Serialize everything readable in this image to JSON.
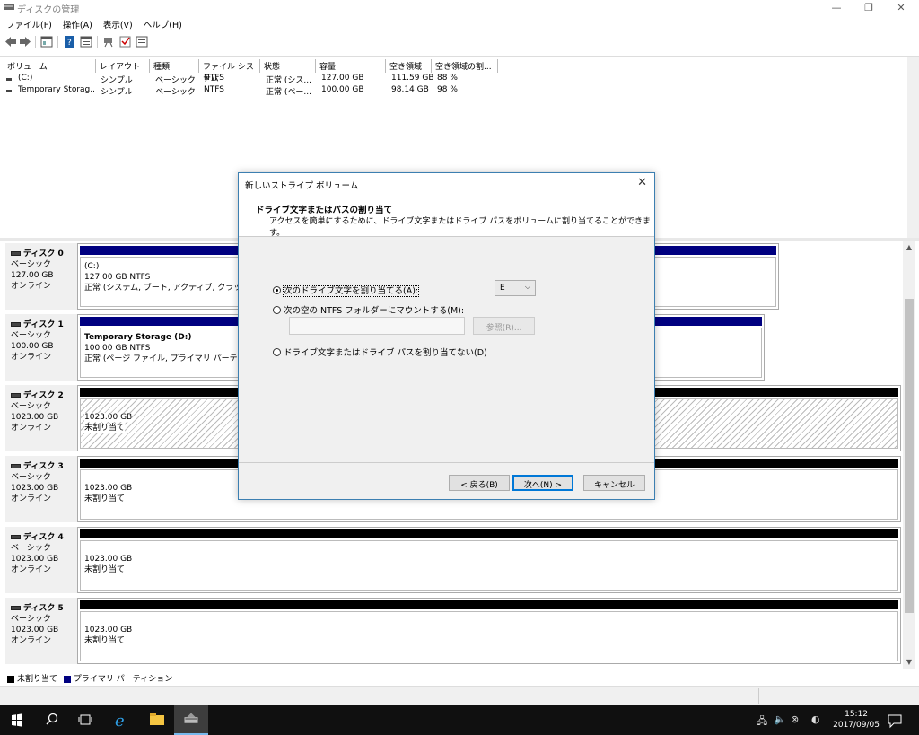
{
  "window": {
    "title": "ディスクの管理",
    "minimize_icon": "—",
    "restore_icon": "❐",
    "close_icon": "✕"
  },
  "menu": [
    {
      "label": "ファイル(F)"
    },
    {
      "label": "操作(A)"
    },
    {
      "label": "表示(V)"
    },
    {
      "label": "ヘルプ(H)"
    }
  ],
  "toolbar": {
    "icons": [
      "back-arrow-icon",
      "forward-arrow-icon",
      "console-tree-icon",
      "help-icon",
      "properties-icon",
      "connect-icon",
      "check-icon",
      "list-icon"
    ]
  },
  "volume_list": {
    "columns": [
      "ボリューム",
      "レイアウト",
      "種類",
      "ファイル システム",
      "状態",
      "容量",
      "空き領域",
      "空き領域の割..."
    ],
    "rows": [
      [
        "(C:)",
        "シンプル",
        "ベーシック",
        "NTFS",
        "正常 (シス...",
        "127.00 GB",
        "111.59 GB",
        "88 %"
      ],
      [
        "Temporary Storag...",
        "シンプル",
        "ベーシック",
        "NTFS",
        "正常 (ペー...",
        "100.00 GB",
        "98.14 GB",
        "98 %"
      ]
    ]
  },
  "disks": [
    {
      "name": "ディスク 0",
      "type": "ベーシック",
      "size": "127.00 GB",
      "status": "オンライン",
      "part_title": "(C:)",
      "part_size": "127.00 GB NTFS",
      "part_status": "正常 (システム, ブート, アクティブ, クラッシュ ダン"
    },
    {
      "name": "ディスク 1",
      "type": "ベーシック",
      "size": "100.00 GB",
      "status": "オンライン",
      "part_title": "Temporary Storage  (D:)",
      "part_size": "100.00 GB NTFS",
      "part_status": "正常 (ページ ファイル, プライマリ パーティション)"
    },
    {
      "name": "ディスク 2",
      "type": "ベーシック",
      "size": "1023.00 GB",
      "status": "オンライン",
      "part_size": "1023.00 GB",
      "part_status": "未割り当て"
    },
    {
      "name": "ディスク 3",
      "type": "ベーシック",
      "size": "1023.00 GB",
      "status": "オンライン",
      "part_size": "1023.00 GB",
      "part_status": "未割り当て"
    },
    {
      "name": "ディスク 4",
      "type": "ベーシック",
      "size": "1023.00 GB",
      "status": "オンライン",
      "part_size": "1023.00 GB",
      "part_status": "未割り当て"
    },
    {
      "name": "ディスク 5",
      "type": "ベーシック",
      "size": "1023.00 GB",
      "status": "オンライン",
      "part_size": "1023.00 GB",
      "part_status": "未割り当て"
    }
  ],
  "legend": {
    "unallocated": "未割り当て",
    "primary": "プライマリ パーティション",
    "unallocated_color": "#000000",
    "primary_color": "#000080"
  },
  "dialog": {
    "title": "新しいストライプ ボリューム",
    "heading": "ドライブ文字またはパスの割り当て",
    "subheading": "アクセスを簡単にするために、ドライブ文字またはドライブ パスをボリュームに割り当てることができます。",
    "option_letter": "次のドライブ文字を割り当てる(A):",
    "option_folder": "次の空の NTFS フォルダーにマウントする(M):",
    "option_none": "ドライブ文字またはドライブ パスを割り当てない(D)",
    "selected_option": "letter",
    "drive_letter": "E",
    "browse_label": "参照(R)...",
    "back_label": "< 戻る(B)",
    "next_label": "次へ(N) >",
    "cancel_label": "キャンセル",
    "close_icon": "✕"
  },
  "taskbar": {
    "time": "15:12",
    "date": "2017/09/05"
  }
}
